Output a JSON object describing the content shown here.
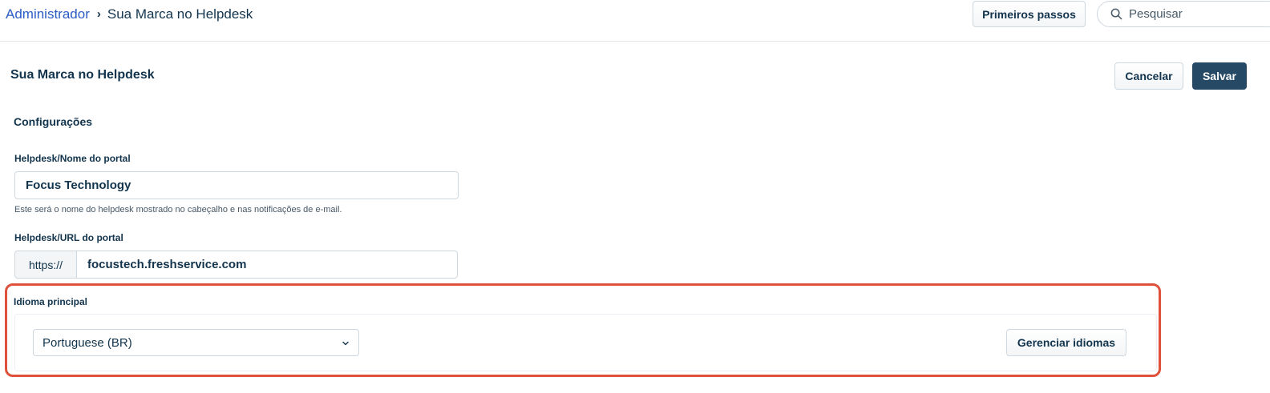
{
  "breadcrumb": {
    "root": "Administrador",
    "separator": "›",
    "current": "Sua Marca no Helpdesk"
  },
  "header": {
    "getting_started_label": "Primeiros passos",
    "search_placeholder": "Pesquisar"
  },
  "page": {
    "title": "Sua Marca no Helpdesk",
    "cancel_label": "Cancelar",
    "save_label": "Salvar"
  },
  "settings": {
    "section_title": "Configurações",
    "portal_name": {
      "label": "Helpdesk/Nome do portal",
      "value": "Focus Technology",
      "hint": "Este será o nome do helpdesk mostrado no cabeçalho e nas notificações de e-mail."
    },
    "portal_url": {
      "label": "Helpdesk/URL do portal",
      "prefix": "https://",
      "value": "focustech.freshservice.com"
    },
    "primary_language": {
      "label": "Idioma principal",
      "selected": "Portuguese (BR)",
      "manage_label": "Gerenciar idiomas"
    }
  },
  "colors": {
    "link": "#2c5cc5",
    "text": "#12344d",
    "primary_button": "#264966",
    "highlight_border": "#e0513b"
  }
}
